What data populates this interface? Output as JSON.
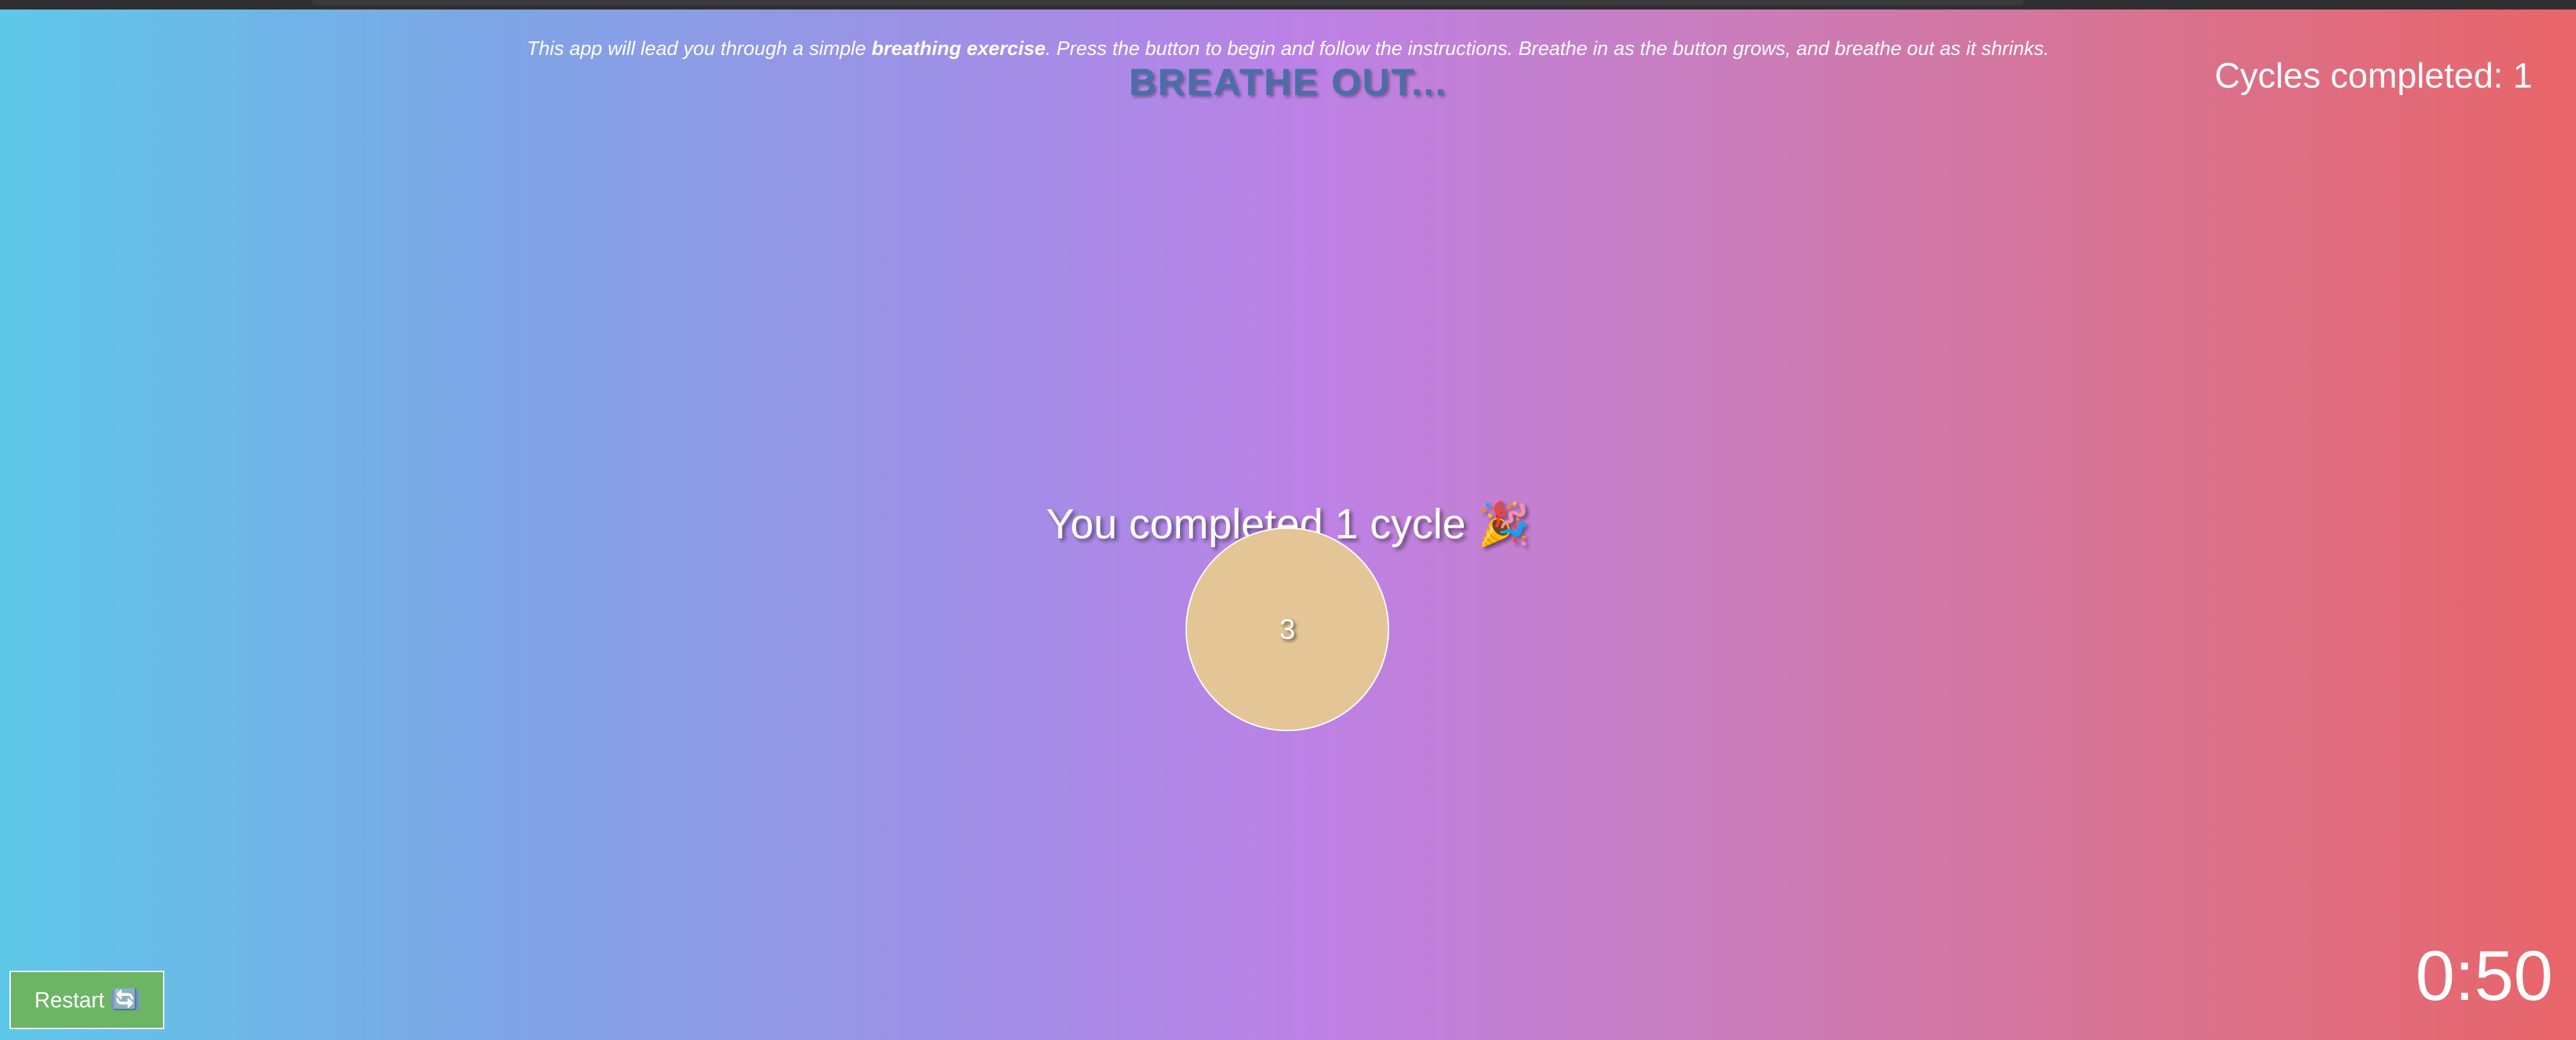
{
  "intro": {
    "text_before": "This app will lead you through a simple ",
    "text_bold": "breathing exercise",
    "text_after": ". Press the button to begin and follow the instructions. Breathe in as the button grows, and breathe out as it shrinks."
  },
  "phase": {
    "title": "BREATHE OUT..."
  },
  "status": {
    "cycles_label": "Cycles completed: 1"
  },
  "message": {
    "completed": "You completed 1 cycle",
    "emoji": "🎉"
  },
  "breath_button": {
    "count": "3"
  },
  "controls": {
    "restart_label": "Restart",
    "restart_icon": "🔄"
  },
  "timer": {
    "value": "0:50"
  },
  "colors": {
    "circle_fill": "#e4c596",
    "restart_button": "#6cb564",
    "phase_title": "#4a6fa8",
    "gradient_left": "#5ec8e8",
    "gradient_mid": "#bd81e6",
    "gradient_right": "#e86568"
  }
}
